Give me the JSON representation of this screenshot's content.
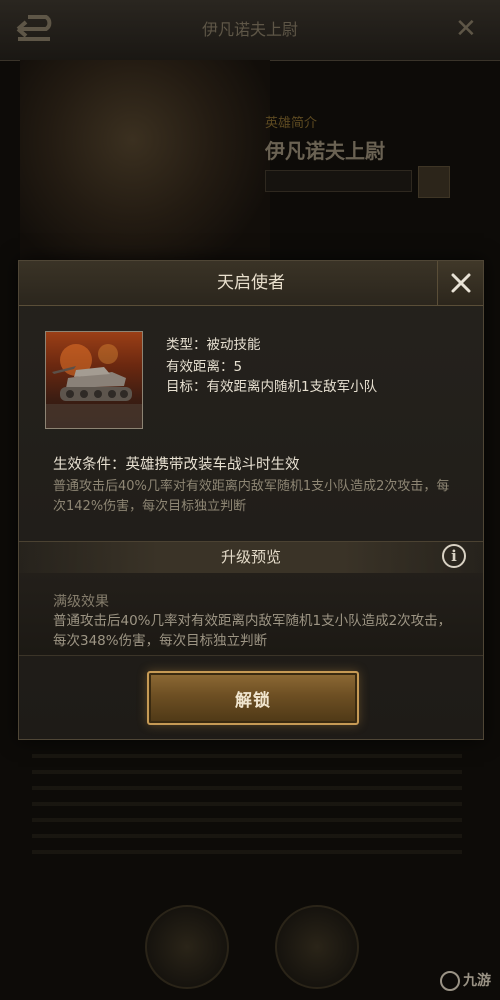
{
  "background": {
    "hero_name": "伊凡诺夫上尉",
    "hero_name_faded": "伊凡诺夫上尉",
    "hero_subtitle": "英雄简介"
  },
  "dialog": {
    "title": "天启使者",
    "close_icon": "close-icon",
    "skill": {
      "type_line": "类型：被动技能",
      "range_line": "有效距离：5",
      "target_line": "目标：有效距离内随机1支敌军小队"
    },
    "condition": "生效条件：英雄携带改装车战斗时生效",
    "effect_text": "普通攻击后40%几率对有效距离内敌军随机1支小队造成2次攻击，每次142%伤害，每次目标独立判断",
    "upgrade_preview_label": "升级预览",
    "info_icon": "info-icon",
    "max_effect_title": "满级效果",
    "max_effect_text": "普通攻击后40%几率对有效距离内敌军随机1支小队造成2次攻击，每次348%伤害，每次目标独立判断",
    "unlock_label": "解锁"
  },
  "watermark": "九游",
  "colors": {
    "accent_gold": "#c69a55",
    "panel_bg": "#25221d"
  }
}
